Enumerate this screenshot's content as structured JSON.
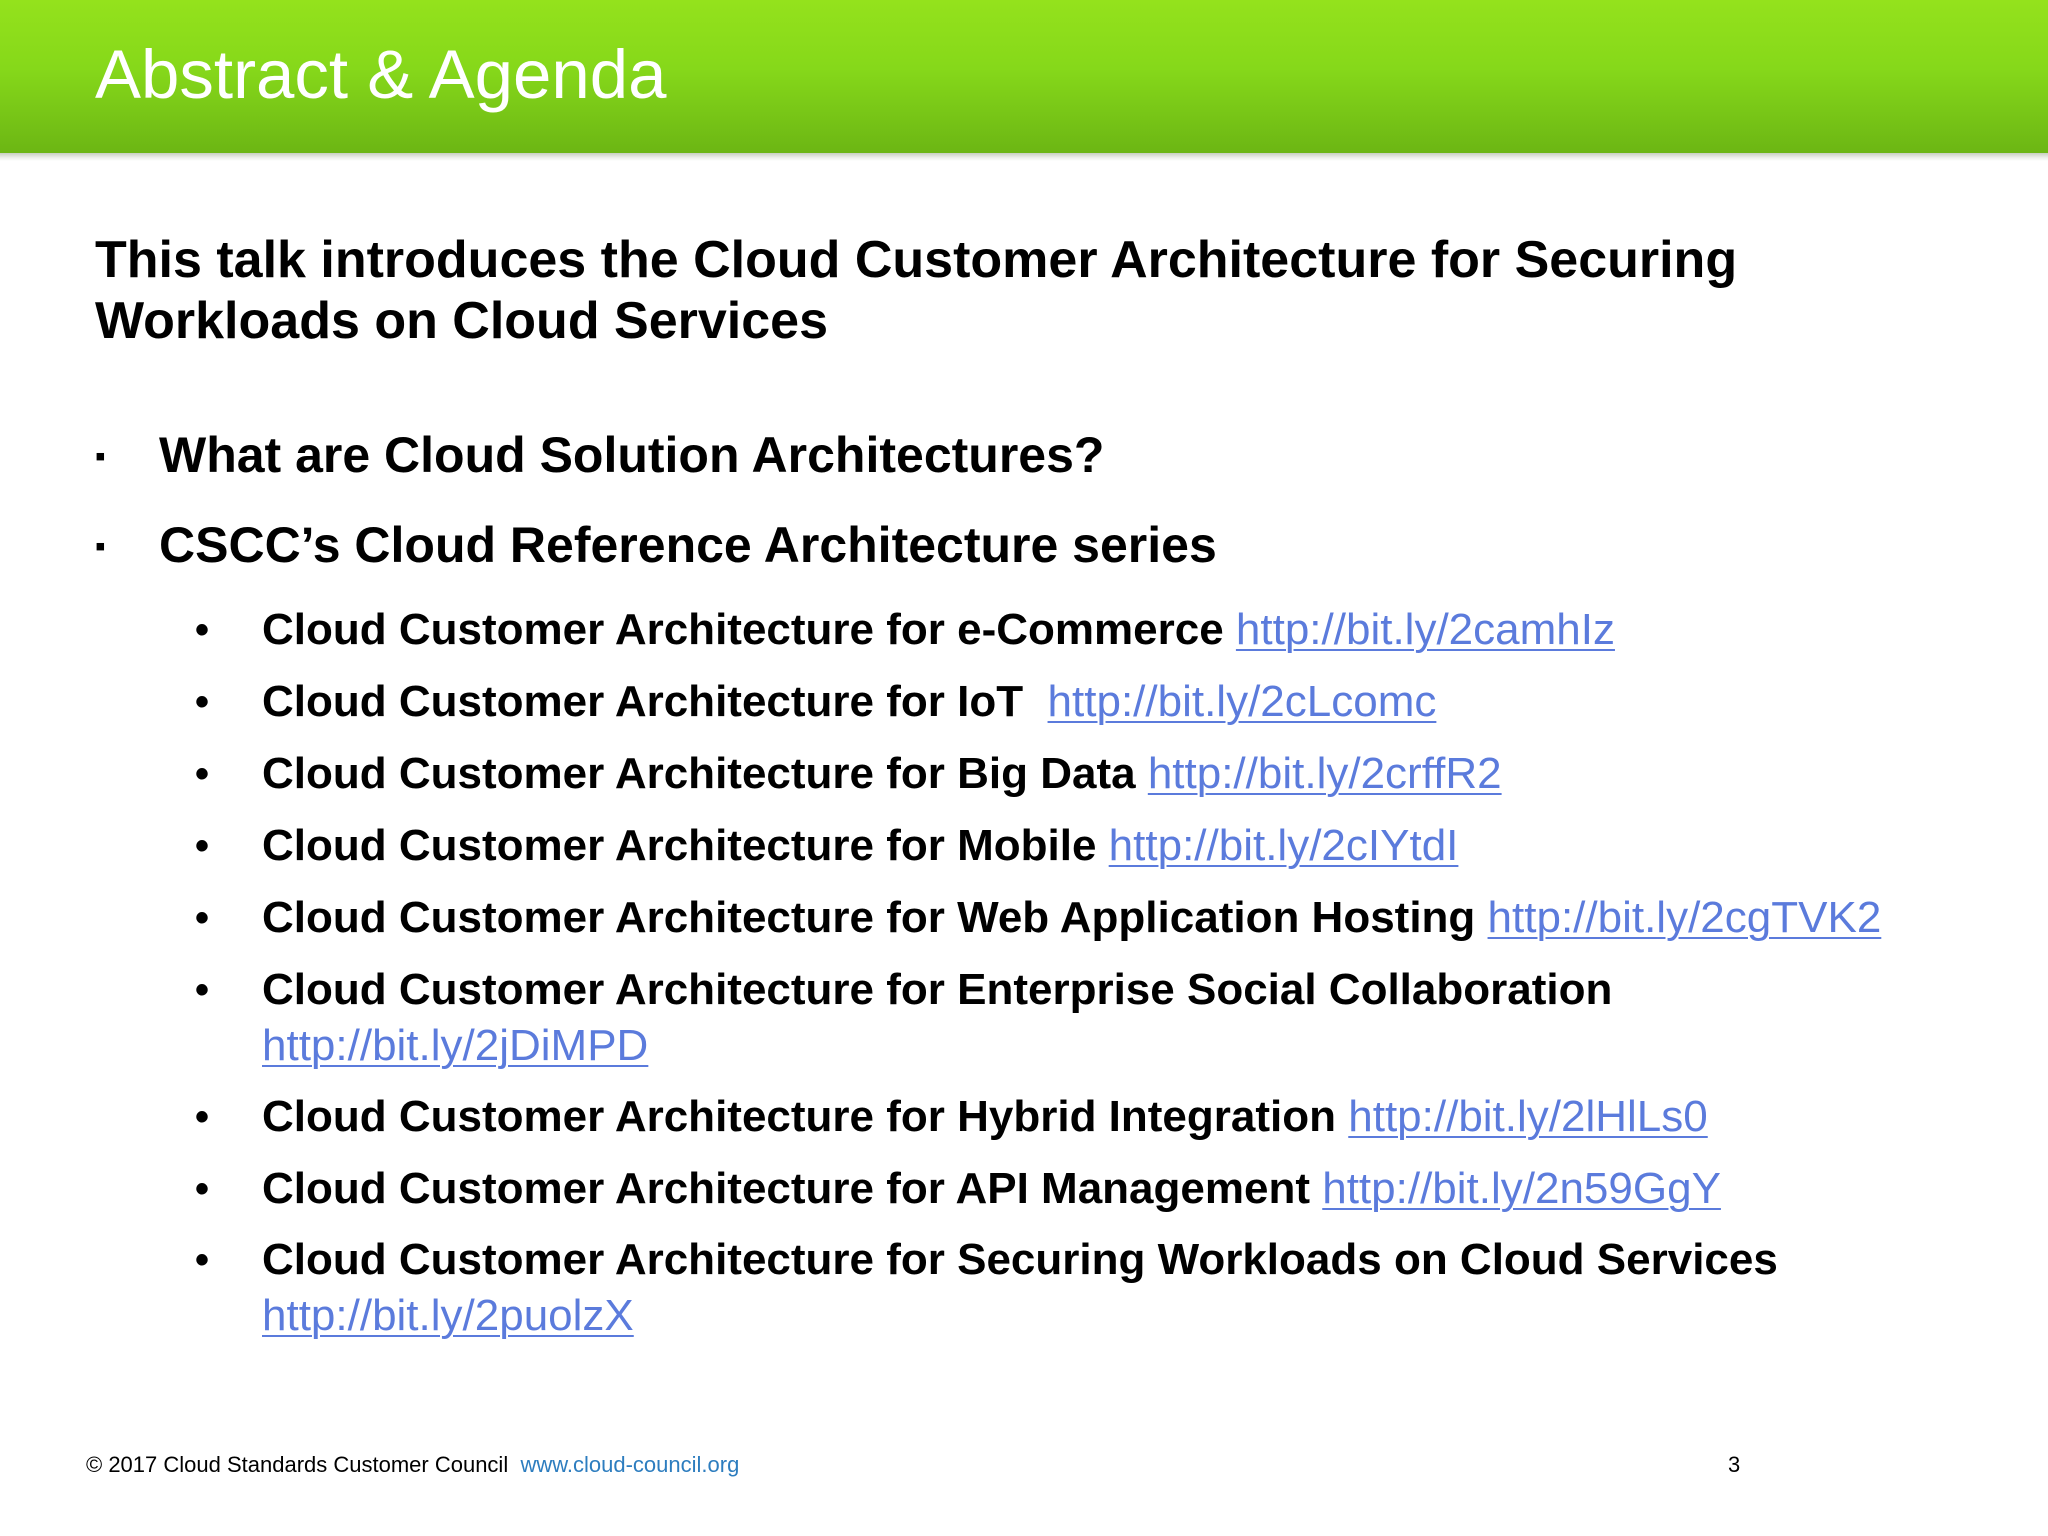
{
  "slide": {
    "title": "Abstract & Agenda",
    "intro": "This talk introduces the Cloud Customer Architecture for Securing Workloads on Cloud Services",
    "bullets": [
      {
        "marker": "▪",
        "text": "What are Cloud Solution Architectures?"
      },
      {
        "marker": "▪",
        "text": "CSCC’s Cloud Reference Architecture series"
      }
    ],
    "subbullets": [
      {
        "marker": "•",
        "text": "Cloud Customer Architecture for e-Commerce",
        "link": "http://bit.ly/2camhIz"
      },
      {
        "marker": "•",
        "text": "Cloud Customer Architecture for IoT",
        "link": "http://bit.ly/2cLcomc"
      },
      {
        "marker": "•",
        "text": "Cloud Customer Architecture for Big Data",
        "link": "http://bit.ly/2crffR2"
      },
      {
        "marker": "•",
        "text": "Cloud Customer Architecture for Mobile",
        "link": "http://bit.ly/2cIYtdI"
      },
      {
        "marker": "•",
        "text": "Cloud Customer Architecture for Web Application Hosting",
        "link": "http://bit.ly/2cgTVK2"
      },
      {
        "marker": "•",
        "text": "Cloud Customer Architecture for Enterprise Social Collaboration",
        "link": "http://bit.ly/2jDiMPD"
      },
      {
        "marker": "•",
        "text": "Cloud Customer Architecture for Hybrid Integration",
        "link": "http://bit.ly/2lHlLs0"
      },
      {
        "marker": "•",
        "text": "Cloud Customer Architecture for API Management",
        "link": "http://bit.ly/2n59GgY"
      },
      {
        "marker": "•",
        "text": "Cloud Customer Architecture for Securing Workloads on Cloud Services",
        "link": "http://bit.ly/2puolzX"
      }
    ]
  },
  "footer": {
    "copyright": "© 2017 Cloud Standards Customer Council",
    "website": "www.cloud-council.org",
    "page_number": "3"
  },
  "colors": {
    "header_green": "#86d81a",
    "link_blue": "#5b7bdc",
    "footer_link": "#2d7dbf"
  }
}
